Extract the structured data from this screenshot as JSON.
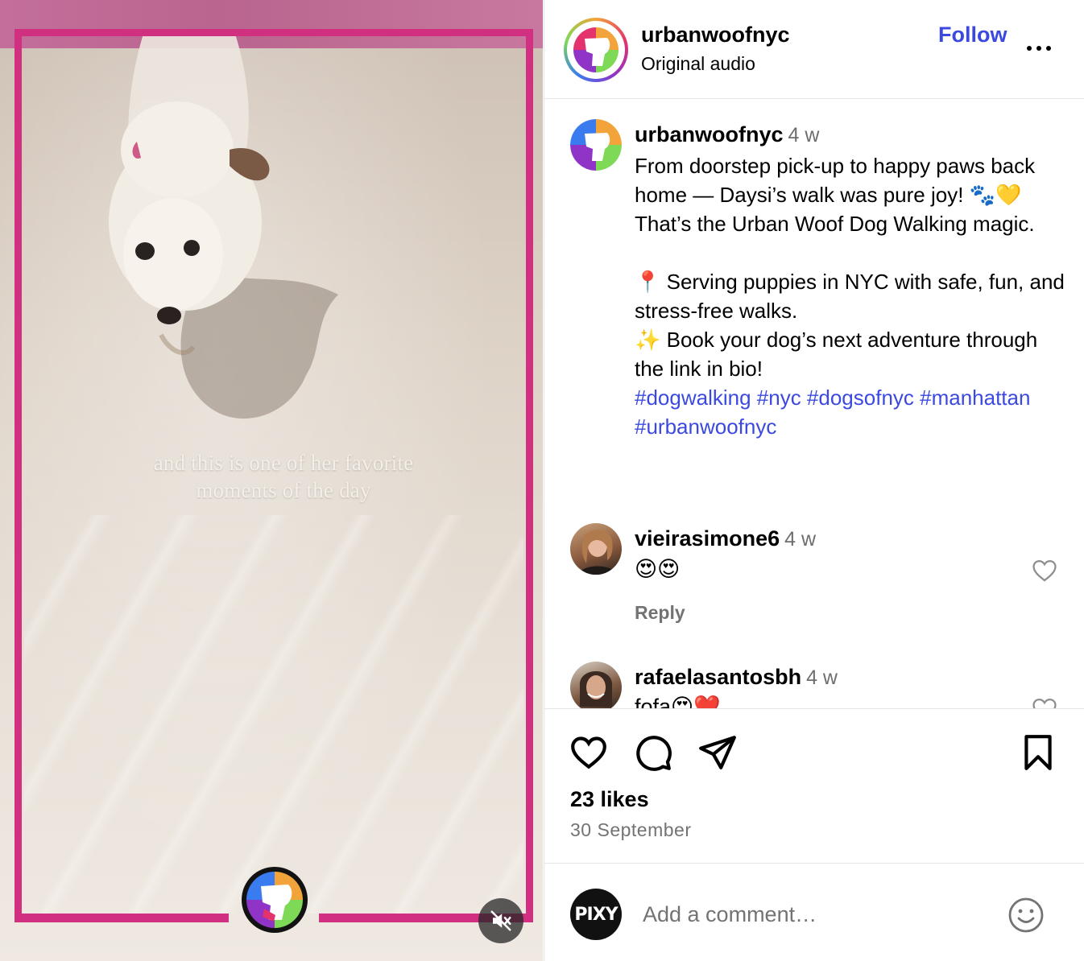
{
  "media": {
    "overlay_text_line1": "and this is one of her favorite",
    "overlay_text_line2": "moments of the day",
    "mute_icon": "speaker-muted-icon",
    "frame_color": "#d12f7f"
  },
  "header": {
    "username": "urbanwoofnyc",
    "audio": "Original audio",
    "follow_label": "Follow",
    "more_icon": "more-options-icon"
  },
  "caption": {
    "username": "urbanwoofnyc",
    "time": "4 w",
    "line1": "From doorstep pick-up to happy paws back home — Daysi’s walk was pure joy! 🐾💛 That’s the Urban Woof Dog Walking magic.",
    "line2": "📍 Serving puppies in NYC with safe, fun, and stress-free walks.",
    "line3": "✨ Book your dog’s next adventure through the link in bio!",
    "hashtags": "#dogwalking #nyc #dogsofnyc #manhattan #urbanwoofnyc"
  },
  "comments": [
    {
      "username": "vieirasimone6",
      "time": "4 w",
      "text": "😍😍",
      "reply_label": "Reply"
    },
    {
      "username": "rafaelasantosbh",
      "time": "4 w",
      "text": "fofa😍❤️"
    }
  ],
  "actions": {
    "likes": "23 likes",
    "date": "30 September"
  },
  "composer": {
    "avatar_text": "PIXY",
    "placeholder": "Add a comment…"
  },
  "colors": {
    "link_blue": "#3b49df",
    "muted_gray": "#737373",
    "brand_pink": "#d12f7f"
  }
}
